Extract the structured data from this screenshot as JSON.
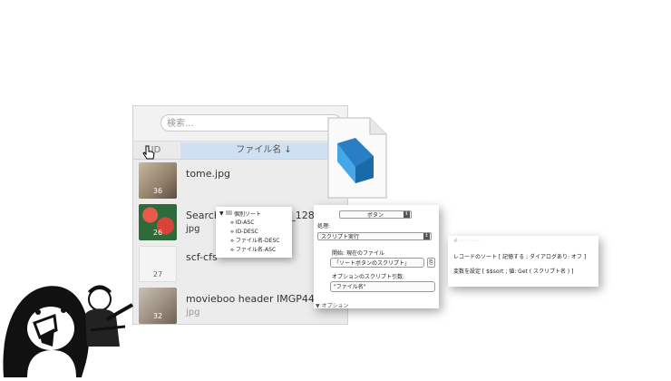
{
  "search": {
    "placeholder": "検索..."
  },
  "list": {
    "headers": {
      "id": "ID",
      "name": "ファイル名 ↓"
    },
    "rows": [
      {
        "id": "36",
        "line1": "tome.jpg",
        "line2": ""
      },
      {
        "id": "26",
        "line1": "Search B.............160_128.",
        "line2": "jpg"
      },
      {
        "id": "27",
        "line1": "scf-cfs",
        "line2": ""
      },
      {
        "id": "32",
        "line1": "movieboo header IMGP4402.",
        "line2": "jpg"
      }
    ]
  },
  "sort_popup": {
    "title": "個別ソート",
    "items": [
      "ID-ASC",
      "ID-DESC",
      "ファイル名-DESC",
      "ファイル名-ASC"
    ]
  },
  "button_panel": {
    "dropdown": "ボタン",
    "process_label": "処理:",
    "action": "スクリプト実行",
    "start_label": "開始:",
    "start_value": "現在のファイル",
    "script_value": "「ソートボタンのスクリプト」",
    "param_label": "オプションのスクリプト引数:",
    "param_value": "\"ファイル名\"",
    "options_label": "▼ オプション"
  },
  "script_panel": {
    "faded_line": "# ⋯ ⋯ ⋯",
    "line1": "レコードのソート [ 記憶する ; ダイアログあり: オフ ]",
    "line2": "変数を設定 [ $$sort ; 値: Get ( スクリプト名 ) ]"
  },
  "colors": {
    "accent": "#2f8fd8",
    "header_selected": "#cfe0f3",
    "window_bg": "#ececec"
  }
}
